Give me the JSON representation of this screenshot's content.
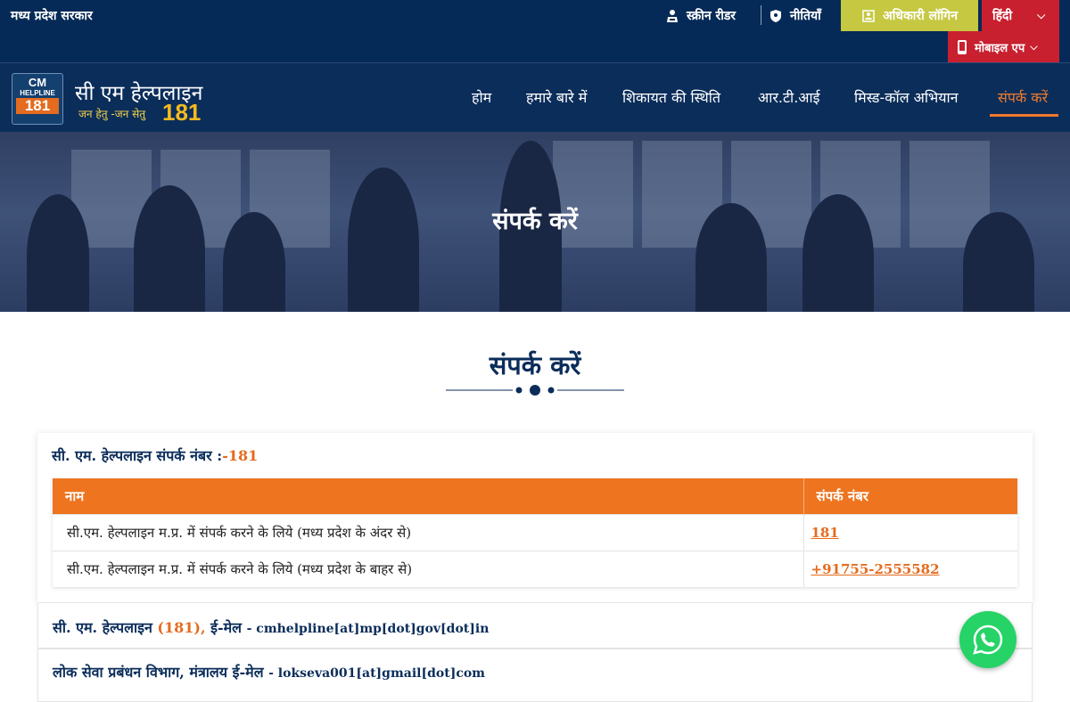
{
  "topbar": {
    "gov_name": "मध्य प्रदेश सरकार",
    "screen_reader": "स्क्रीन रीडर",
    "policies": "नीतियाँ",
    "officer_login": "अधिकारी लॉगिन",
    "language": "हिंदी",
    "mobile_app": "मोबाइल एप"
  },
  "logo": {
    "cm": "CM",
    "helpline": "HELPLINE",
    "number": "181",
    "title": "सी एम हेल्पलाइन",
    "tagline": "जन हेतु -जन सेतु",
    "big_number": "181"
  },
  "nav": {
    "items": [
      {
        "label": "होम"
      },
      {
        "label": "हमारे बारे में"
      },
      {
        "label": "शिकायत की स्थिति"
      },
      {
        "label": "आर.टी.आई"
      },
      {
        "label": "मिस्ड-कॉल अभियान"
      },
      {
        "label": "संपर्क करें"
      }
    ],
    "active_color": "#f07a2b"
  },
  "hero": {
    "title": "संपर्क करें"
  },
  "section": {
    "title": "संपर्क करें"
  },
  "contact_card": {
    "heading": "सी. एम. हेल्पलाइन संपर्क नंबर :",
    "heading_number": "-181",
    "table": {
      "headers": [
        "नाम",
        "संपर्क नंबर"
      ],
      "rows": [
        {
          "name": "सी.एम. हेल्पलाइन म.प्र. में संपर्क करने के लिये (मध्य प्रदेश के अंदर से)",
          "number": "181"
        },
        {
          "name": "सी.एम. हेल्पलाइन म.प्र. में संपर्क करने के लिये (मध्य प्रदेश के बाहर से)",
          "number": "+91755-2555582"
        }
      ]
    }
  },
  "email_rows": [
    {
      "label": "सी. एम. हेल्पलाइन",
      "orange": "(181),",
      "label2": "ई-मेल",
      "email": "- cmhelpline[at]mp[dot]gov[dot]in"
    },
    {
      "label": "लोक सेवा प्रबंधन विभाग, मंत्रालय ई-मेल",
      "orange": "",
      "label2": "",
      "email": "- lokseva001[at]gmail[dot]com"
    }
  ],
  "colors": {
    "navy": "#0b2d5a",
    "orange": "#ee7420",
    "red": "#c8202f",
    "olive": "#c6c842",
    "whatsapp": "#25d366"
  }
}
